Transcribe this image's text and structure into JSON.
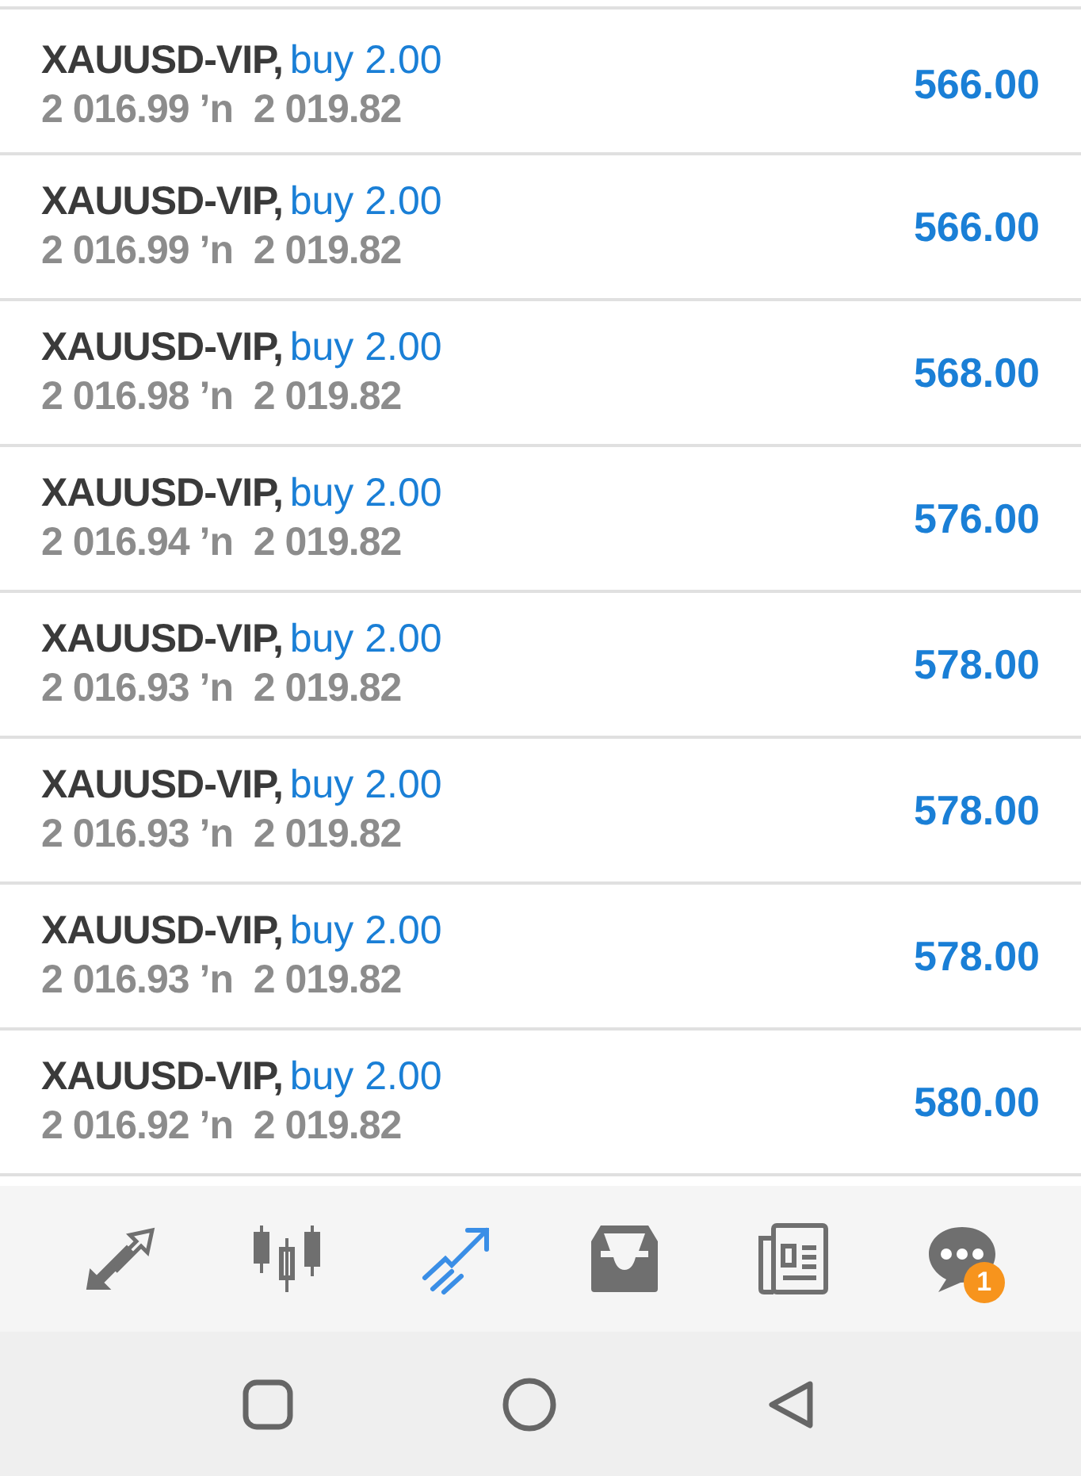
{
  "positions": [
    {
      "symbol": "XAUUSD-VIP,",
      "order": "buy 2.00",
      "prices": "2 016.99 ʼn  2 019.82",
      "profit": "566.00"
    },
    {
      "symbol": "XAUUSD-VIP,",
      "order": "buy 2.00",
      "prices": "2 016.99 ʼn  2 019.82",
      "profit": "566.00"
    },
    {
      "symbol": "XAUUSD-VIP,",
      "order": "buy 2.00",
      "prices": "2 016.98 ʼn  2 019.82",
      "profit": "568.00"
    },
    {
      "symbol": "XAUUSD-VIP,",
      "order": "buy 2.00",
      "prices": "2 016.94 ʼn  2 019.82",
      "profit": "576.00"
    },
    {
      "symbol": "XAUUSD-VIP,",
      "order": "buy 2.00",
      "prices": "2 016.93 ʼn  2 019.82",
      "profit": "578.00"
    },
    {
      "symbol": "XAUUSD-VIP,",
      "order": "buy 2.00",
      "prices": "2 016.93 ʼn  2 019.82",
      "profit": "578.00"
    },
    {
      "symbol": "XAUUSD-VIP,",
      "order": "buy 2.00",
      "prices": "2 016.93 ʼn  2 019.82",
      "profit": "578.00"
    },
    {
      "symbol": "XAUUSD-VIP,",
      "order": "buy 2.00",
      "prices": "2 016.92 ʼn  2 019.82",
      "profit": "580.00"
    }
  ],
  "bottom_nav": [
    {
      "kind": "quotes",
      "selected": false
    },
    {
      "kind": "chart",
      "selected": false
    },
    {
      "kind": "trade",
      "selected": true
    },
    {
      "kind": "history",
      "selected": false
    },
    {
      "kind": "news",
      "selected": false
    },
    {
      "kind": "messages",
      "selected": false,
      "badge": "1"
    }
  ]
}
